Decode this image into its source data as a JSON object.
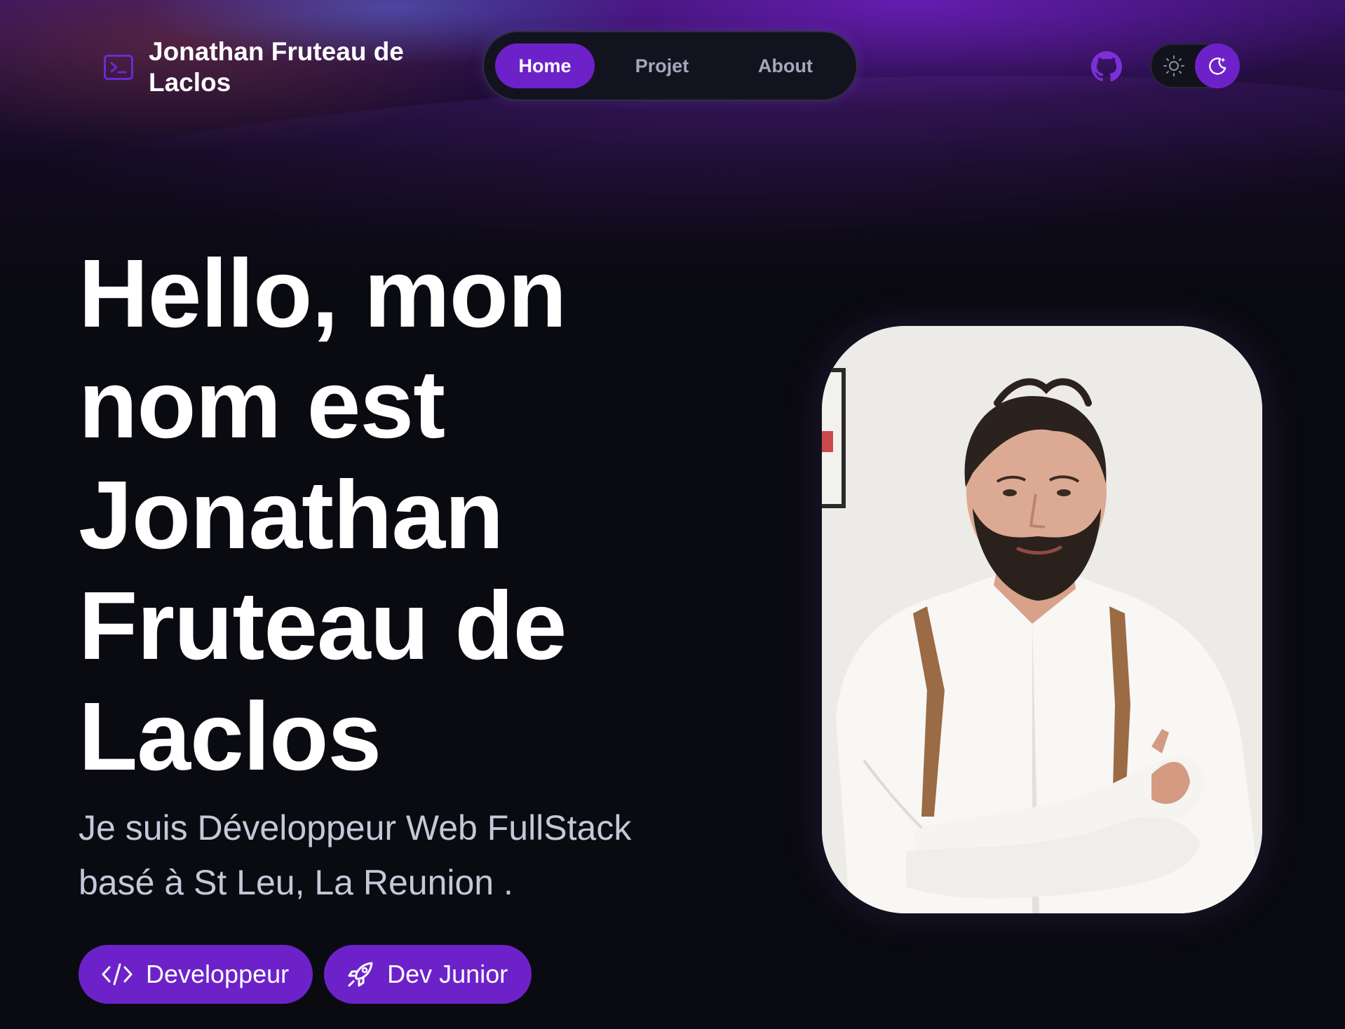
{
  "header": {
    "brand_name": "Jonathan Fruteau de Laclos",
    "brand_icon": "terminal-icon",
    "nav": [
      {
        "label": "Home",
        "active": true
      },
      {
        "label": "Projet",
        "active": false
      },
      {
        "label": "About",
        "active": false
      }
    ],
    "github_icon": "github-icon",
    "theme_toggle": {
      "light_icon": "sun-icon",
      "dark_icon": "moon-icon",
      "mode": "dark"
    }
  },
  "hero": {
    "title": "Hello, mon nom est Jonathan Fruteau de Laclos",
    "subtitle": "Je suis Développeur Web FullStack basé à St Leu, La Reunion .",
    "tags": [
      {
        "label": "Developpeur",
        "icon": "code-icon"
      },
      {
        "label": "Dev Junior",
        "icon": "rocket-icon"
      }
    ],
    "photo": "portrait-photo"
  },
  "colors": {
    "accent": "#6d22c9",
    "background": "#0a0a11",
    "nav_bg": "#131320",
    "muted_text": "#a3a8bb",
    "subtitle_text": "#c4c8d8"
  }
}
